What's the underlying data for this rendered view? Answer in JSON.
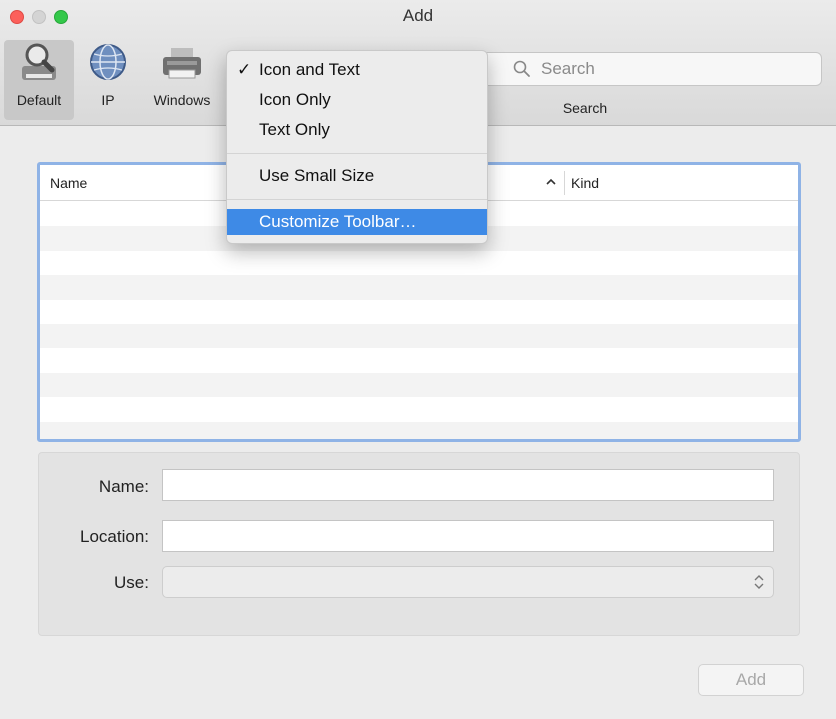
{
  "window": {
    "title": "Add"
  },
  "toolbar": {
    "items": [
      {
        "label": "Default",
        "icon": "magnifier-printer-icon",
        "selected": true
      },
      {
        "label": "IP",
        "icon": "globe-icon",
        "selected": false
      },
      {
        "label": "Windows",
        "icon": "printer-icon",
        "selected": false
      }
    ],
    "search": {
      "placeholder": "Search",
      "label": "Search"
    }
  },
  "context_menu": {
    "items": [
      {
        "label": "Icon and Text",
        "checked": true,
        "check_mark": "✓"
      },
      {
        "label": "Icon Only",
        "checked": false
      },
      {
        "label": "Text Only",
        "checked": false
      },
      {
        "label": "Use Small Size",
        "checked": false
      },
      {
        "label": "Customize Toolbar…",
        "highlighted": true
      }
    ]
  },
  "table": {
    "columns": [
      "Name",
      "Kind"
    ],
    "sorted_column": "Name",
    "sort_direction": "ascending",
    "rows": []
  },
  "form": {
    "name_label": "Name:",
    "location_label": "Location:",
    "use_label": "Use:",
    "name_value": "",
    "location_value": "",
    "use_value": ""
  },
  "buttons": {
    "add_label": "Add",
    "add_enabled": false
  },
  "colors": {
    "selection_blue": "#3e8ae6",
    "focus_ring": "#8fb3e6",
    "close": "#fc605b",
    "zoom": "#34c84a"
  }
}
